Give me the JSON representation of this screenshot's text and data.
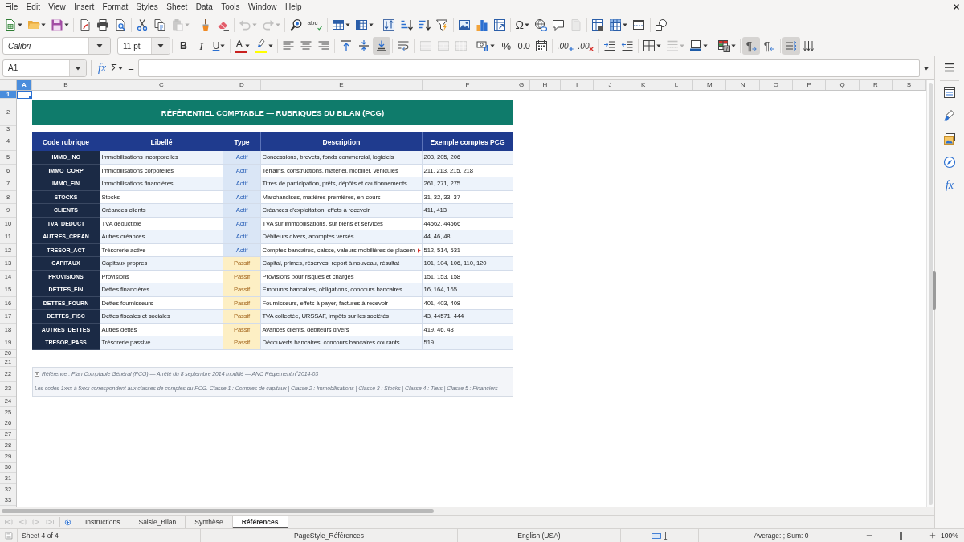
{
  "menu": [
    "File",
    "Edit",
    "View",
    "Insert",
    "Format",
    "Styles",
    "Sheet",
    "Data",
    "Tools",
    "Window",
    "Help"
  ],
  "standard_toolbar": [
    [
      {
        "kind": "new",
        "dropdown": true,
        "disabled": false
      },
      {
        "kind": "open",
        "dropdown": true,
        "disabled": false
      },
      {
        "kind": "save",
        "dropdown": true,
        "disabled": false
      }
    ],
    [
      {
        "kind": "pdf",
        "dropdown": false,
        "disabled": false
      },
      {
        "kind": "print",
        "dropdown": false,
        "disabled": false
      },
      {
        "kind": "preview",
        "dropdown": false,
        "disabled": false
      }
    ],
    [
      {
        "kind": "cut",
        "dropdown": false,
        "disabled": false
      },
      {
        "kind": "copy",
        "dropdown": false,
        "disabled": false
      },
      {
        "kind": "paste",
        "dropdown": true,
        "disabled": true
      }
    ],
    [
      {
        "kind": "brush",
        "dropdown": false,
        "disabled": false
      },
      {
        "kind": "clear",
        "dropdown": false,
        "disabled": false
      }
    ],
    [
      {
        "kind": "undo",
        "dropdown": true,
        "disabled": true
      },
      {
        "kind": "redo",
        "dropdown": true,
        "disabled": true
      }
    ],
    [
      {
        "kind": "find",
        "dropdown": false,
        "disabled": false
      },
      {
        "kind": "spelling",
        "label": "abc",
        "dropdown": false,
        "disabled": false
      }
    ],
    [
      {
        "kind": "rows",
        "dropdown": true,
        "disabled": false
      },
      {
        "kind": "columns",
        "dropdown": true,
        "disabled": false
      }
    ],
    [
      {
        "kind": "sort",
        "dropdown": false,
        "disabled": false
      },
      {
        "kind": "ascending",
        "dropdown": false,
        "disabled": false
      },
      {
        "kind": "descending",
        "dropdown": false,
        "disabled": false
      },
      {
        "kind": "filter",
        "dropdown": false,
        "disabled": false
      }
    ],
    [
      {
        "kind": "image",
        "dropdown": false,
        "disabled": false
      },
      {
        "kind": "chart",
        "dropdown": false,
        "disabled": false
      },
      {
        "kind": "pivot",
        "dropdown": false,
        "disabled": false
      }
    ],
    [
      {
        "kind": "symbol",
        "label": "Ω",
        "dropdown": true,
        "disabled": false
      },
      {
        "kind": "hyperlink",
        "dropdown": false,
        "disabled": false
      },
      {
        "kind": "comment",
        "dropdown": false,
        "disabled": false
      },
      {
        "kind": "headers",
        "dropdown": false,
        "disabled": true
      }
    ],
    [
      {
        "kind": "printarea",
        "dropdown": false,
        "disabled": false
      },
      {
        "kind": "freeze",
        "dropdown": true,
        "disabled": false
      },
      {
        "kind": "split",
        "dropdown": false,
        "disabled": false
      }
    ],
    [
      {
        "kind": "shapes",
        "dropdown": false,
        "disabled": false
      }
    ]
  ],
  "formatting_toolbar": {
    "font_name": "Calibri",
    "font_size": "11 pt",
    "buttons": [
      [
        {
          "kind": "bold",
          "label": "B",
          "dropdown": false,
          "disabled": false,
          "pressed": false
        },
        {
          "kind": "italic",
          "label": "I",
          "dropdown": false,
          "disabled": false,
          "pressed": false
        },
        {
          "kind": "underline",
          "label": "U",
          "dropdown": true,
          "disabled": false,
          "pressed": false
        }
      ],
      [
        {
          "kind": "fontcolor",
          "label": "A",
          "color": "#c9211e",
          "dropdown": true,
          "disabled": false,
          "pressed": false
        },
        {
          "kind": "highlight",
          "color": "#ffff00",
          "dropdown": true,
          "disabled": false,
          "pressed": false
        }
      ],
      [
        {
          "kind": "left",
          "dropdown": false,
          "disabled": false,
          "pressed": false
        },
        {
          "kind": "center",
          "dropdown": false,
          "disabled": false,
          "pressed": false
        },
        {
          "kind": "right",
          "dropdown": false,
          "disabled": false,
          "pressed": false
        }
      ],
      [
        {
          "kind": "top",
          "dropdown": false,
          "disabled": false,
          "pressed": false
        },
        {
          "kind": "middle",
          "dropdown": false,
          "disabled": false,
          "pressed": false
        },
        {
          "kind": "bottom",
          "dropdown": false,
          "disabled": false,
          "pressed": true
        }
      ],
      [
        {
          "kind": "wrap",
          "dropdown": false,
          "disabled": false,
          "pressed": false
        }
      ],
      [
        {
          "kind": "merge",
          "dropdown": false,
          "disabled": true,
          "pressed": false
        },
        {
          "kind": "mergecenter",
          "dropdown": false,
          "disabled": true,
          "pressed": false
        },
        {
          "kind": "unmerge",
          "dropdown": false,
          "disabled": true,
          "pressed": false
        }
      ],
      [
        {
          "kind": "currency",
          "dropdown": true,
          "disabled": false,
          "pressed": false
        },
        {
          "kind": "percent",
          "label": "%",
          "dropdown": false,
          "disabled": false,
          "pressed": false
        },
        {
          "kind": "number",
          "label": "0.0",
          "dropdown": false,
          "disabled": false,
          "pressed": false
        },
        {
          "kind": "date",
          "dropdown": false,
          "disabled": false,
          "pressed": false
        }
      ],
      [
        {
          "kind": "adddecimal",
          "label": ".00",
          "dropdown": false,
          "disabled": false,
          "pressed": false
        },
        {
          "kind": "deletedecimal",
          "label": ".00",
          "dropdown": false,
          "disabled": false,
          "pressed": false
        }
      ],
      [
        {
          "kind": "indent",
          "dropdown": false,
          "disabled": false,
          "pressed": false
        },
        {
          "kind": "outdent",
          "dropdown": false,
          "disabled": false,
          "pressed": false
        }
      ],
      [
        {
          "kind": "borders",
          "dropdown": true,
          "disabled": false,
          "pressed": false
        },
        {
          "kind": "borderstyle",
          "dropdown": true,
          "disabled": true,
          "pressed": false
        },
        {
          "kind": "bordercolor",
          "dropdown": true,
          "disabled": false,
          "pressed": false
        }
      ],
      [
        {
          "kind": "conditional",
          "dropdown": true,
          "disabled": false,
          "pressed": false
        }
      ],
      [
        {
          "kind": "ltr",
          "label": "¶",
          "dropdown": false,
          "disabled": false,
          "pressed": true
        },
        {
          "kind": "rtl",
          "label": "¶",
          "dropdown": false,
          "disabled": false,
          "pressed": false
        }
      ],
      [
        {
          "kind": "direction",
          "dropdown": false,
          "disabled": false,
          "pressed": true
        },
        {
          "kind": "vertical",
          "dropdown": false,
          "disabled": false,
          "pressed": false
        }
      ]
    ]
  },
  "formula_bar": {
    "name_box": "A1",
    "function_wizard": "fx",
    "sum": "Σ",
    "equals": "="
  },
  "sheet": {
    "columns": [
      {
        "label": "A",
        "selected": true
      },
      {
        "label": "B",
        "selected": false
      },
      {
        "label": "C",
        "selected": false
      },
      {
        "label": "D",
        "selected": false
      },
      {
        "label": "E",
        "selected": false
      },
      {
        "label": "F",
        "selected": false
      },
      {
        "label": "G",
        "selected": false
      },
      {
        "label": "H",
        "selected": false
      },
      {
        "label": "I",
        "selected": false
      },
      {
        "label": "J",
        "selected": false
      },
      {
        "label": "K",
        "selected": false
      },
      {
        "label": "L",
        "selected": false
      },
      {
        "label": "M",
        "selected": false
      },
      {
        "label": "N",
        "selected": false
      },
      {
        "label": "O",
        "selected": false
      },
      {
        "label": "P",
        "selected": false
      },
      {
        "label": "Q",
        "selected": false
      },
      {
        "label": "R",
        "selected": false
      },
      {
        "label": "S",
        "selected": false
      }
    ],
    "rows": [
      {
        "label": "1",
        "selected": true
      },
      {
        "label": "2",
        "selected": false
      },
      {
        "label": "3",
        "selected": false
      },
      {
        "label": "4",
        "selected": false
      },
      {
        "label": "5",
        "selected": false
      },
      {
        "label": "6",
        "selected": false
      },
      {
        "label": "7",
        "selected": false
      },
      {
        "label": "8",
        "selected": false
      },
      {
        "label": "9",
        "selected": false
      },
      {
        "label": "10",
        "selected": false
      },
      {
        "label": "11",
        "selected": false
      },
      {
        "label": "12",
        "selected": false
      },
      {
        "label": "13",
        "selected": false
      },
      {
        "label": "14",
        "selected": false
      },
      {
        "label": "15",
        "selected": false
      },
      {
        "label": "16",
        "selected": false
      },
      {
        "label": "17",
        "selected": false
      },
      {
        "label": "18",
        "selected": false
      },
      {
        "label": "19",
        "selected": false
      },
      {
        "label": "20",
        "selected": false
      },
      {
        "label": "21",
        "selected": false
      },
      {
        "label": "22",
        "selected": false
      },
      {
        "label": "23",
        "selected": false
      },
      {
        "label": "24",
        "selected": false
      },
      {
        "label": "25",
        "selected": false
      },
      {
        "label": "26",
        "selected": false
      },
      {
        "label": "27",
        "selected": false
      },
      {
        "label": "28",
        "selected": false
      },
      {
        "label": "29",
        "selected": false
      },
      {
        "label": "30",
        "selected": false
      },
      {
        "label": "31",
        "selected": false
      },
      {
        "label": "32",
        "selected": false
      },
      {
        "label": "33",
        "selected": false
      }
    ],
    "title": "RÉFÉRENTIEL COMPTABLE — RUBRIQUES DU BILAN (PCG)",
    "table": {
      "columns": [
        "Code rubrique",
        "Libellé",
        "Type",
        "Description",
        "Exemple comptes PCG"
      ],
      "rows": [
        {
          "code": "IMMO_INC",
          "label": "Immobilisations incorporelles",
          "type": "Actif",
          "kind": "asset",
          "description": "Concessions, brevets, fonds commercial, logiciels",
          "overflow": false,
          "accounts": "203, 205, 206"
        },
        {
          "code": "IMMO_CORP",
          "label": "Immobilisations corporelles",
          "type": "Actif",
          "kind": "asset",
          "description": "Terrains, constructions, matériel, mobilier, véhicules",
          "overflow": false,
          "accounts": "211, 213, 215, 218"
        },
        {
          "code": "IMMO_FIN",
          "label": "Immobilisations financières",
          "type": "Actif",
          "kind": "asset",
          "description": "Titres de participation, prêts, dépôts et cautionnements",
          "overflow": false,
          "accounts": "261, 271, 275"
        },
        {
          "code": "STOCKS",
          "label": "Stocks",
          "type": "Actif",
          "kind": "asset",
          "description": "Marchandises, matières premières, en-cours",
          "overflow": false,
          "accounts": "31, 32, 33, 37"
        },
        {
          "code": "CLIENTS",
          "label": "Créances clients",
          "type": "Actif",
          "kind": "asset",
          "description": "Créances d'exploitation, effets à recevoir",
          "overflow": false,
          "accounts": "411, 413"
        },
        {
          "code": "TVA_DEDUCT",
          "label": "TVA déductible",
          "type": "Actif",
          "kind": "asset",
          "description": "TVA sur immobilisations, sur biens et services",
          "overflow": false,
          "accounts": "44562, 44566"
        },
        {
          "code": "AUTRES_CREAN",
          "label": "Autres créances",
          "type": "Actif",
          "kind": "asset",
          "description": "Débiteurs divers, acomptes versés",
          "overflow": false,
          "accounts": "44, 46, 48"
        },
        {
          "code": "TRESOR_ACT",
          "label": "Trésorerie active",
          "type": "Actif",
          "kind": "asset",
          "description": "Comptes bancaires, caisse, valeurs mobilières de placem",
          "overflow": true,
          "accounts": "512, 514, 531"
        },
        {
          "code": "CAPITAUX",
          "label": "Capitaux propres",
          "type": "Passif",
          "kind": "liability",
          "description": "Capital, primes, réserves, report à nouveau, résultat",
          "overflow": false,
          "accounts": "101, 104, 106, 110, 120"
        },
        {
          "code": "PROVISIONS",
          "label": "Provisions",
          "type": "Passif",
          "kind": "liability",
          "description": "Provisions pour risques et charges",
          "overflow": false,
          "accounts": "151, 153, 158"
        },
        {
          "code": "DETTES_FIN",
          "label": "Dettes financières",
          "type": "Passif",
          "kind": "liability",
          "description": "Emprunts bancaires, obligations, concours bancaires",
          "overflow": false,
          "accounts": "16, 164, 165"
        },
        {
          "code": "DETTES_FOURN",
          "label": "Dettes fournisseurs",
          "type": "Passif",
          "kind": "liability",
          "description": "Fournisseurs, effets à payer, factures à recevoir",
          "overflow": false,
          "accounts": "401, 403, 408"
        },
        {
          "code": "DETTES_FISC",
          "label": "Dettes fiscales et sociales",
          "type": "Passif",
          "kind": "liability",
          "description": "TVA collectée, URSSAF, impôts sur les sociétés",
          "overflow": false,
          "accounts": "43, 44571, 444"
        },
        {
          "code": "AUTRES_DETTES",
          "label": "Autres dettes",
          "type": "Passif",
          "kind": "liability",
          "description": "Avances clients, débiteurs divers",
          "overflow": false,
          "accounts": "419, 46, 48"
        },
        {
          "code": "TRESOR_PASS",
          "label": "Trésorerie passive",
          "type": "Passif",
          "kind": "liability",
          "description": "Découverts bancaires, concours bancaires courants",
          "overflow": false,
          "accounts": "519"
        }
      ]
    },
    "notes": [
      {
        "kind": "reference",
        "text": "Référence : Plan Comptable Général (PCG) — Arrêté du 8 septembre 2014 modifié — ANC Règlement n°2014-03"
      },
      {
        "kind": "legend",
        "text": "Les codes 1xxx à 5xxx correspondent aux classes de comptes du PCG. Classe 1 : Comptes de capitaux | Classe 2 : Immobilisations | Classe 3 : Stocks | Classe 4 : Tiers | Classe 5 : Financiers"
      }
    ]
  },
  "sheet_tabs": [
    {
      "label": "Instructions",
      "selected": false
    },
    {
      "label": "Saisie_Bilan",
      "selected": false
    },
    {
      "label": "Synthèse",
      "selected": false
    },
    {
      "label": "Références",
      "selected": true
    }
  ],
  "sidebar": {
    "functions": "fx"
  },
  "status_bar": {
    "sheet": "Sheet 4 of 4",
    "page_style": "PageStyle_Références",
    "language": "English (USA)",
    "summary": "Average: ; Sum: 0",
    "zoom": {
      "level": 0.5,
      "reading": "100%"
    }
  }
}
